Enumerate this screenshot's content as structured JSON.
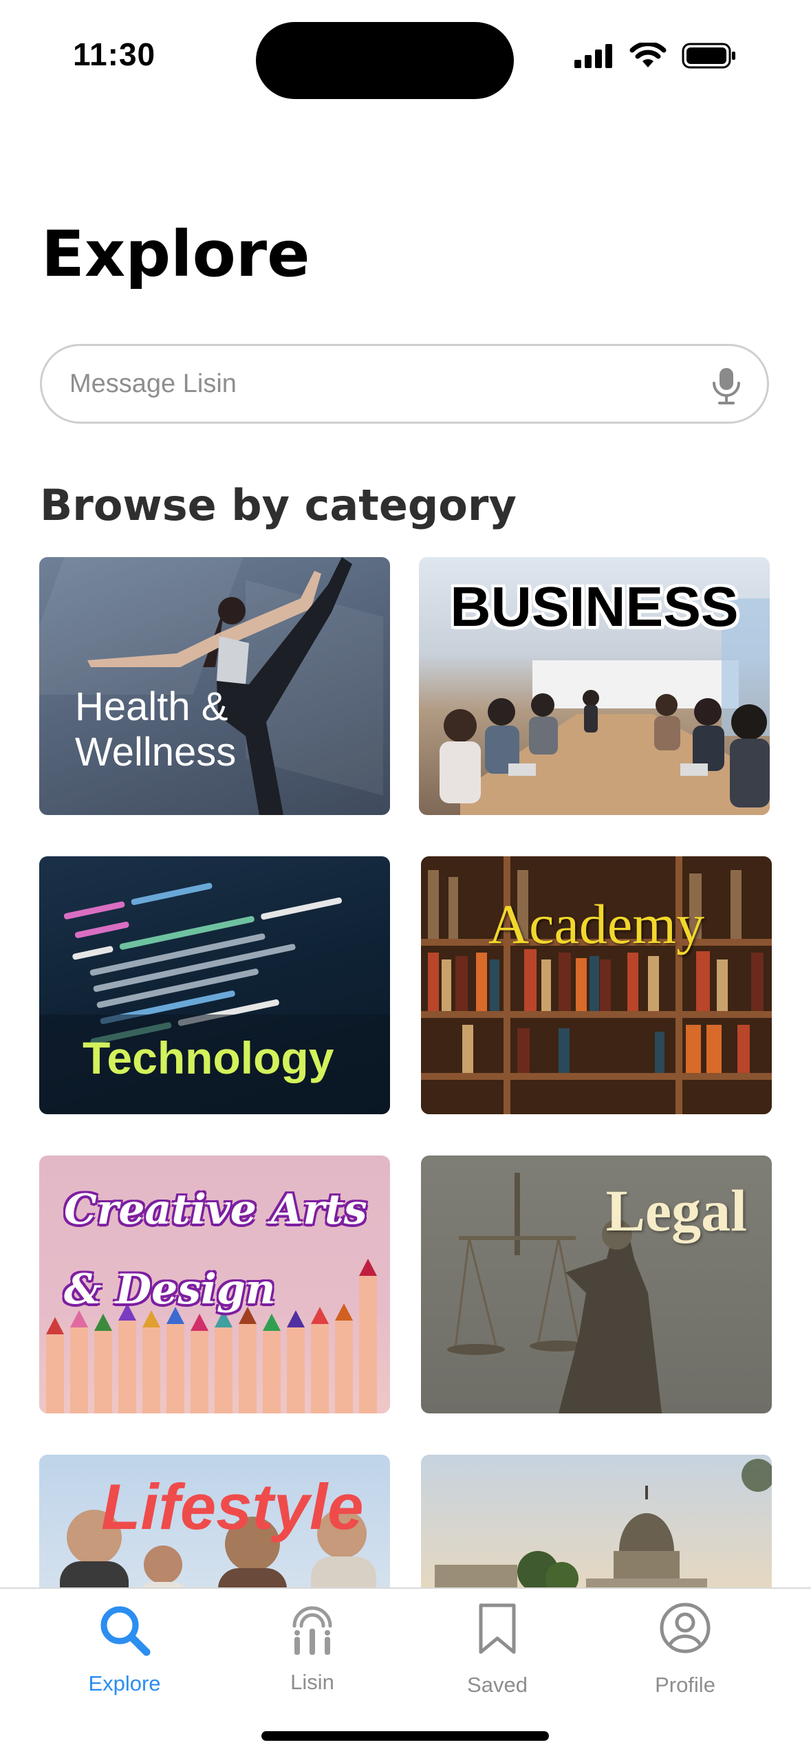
{
  "status_bar": {
    "time": "11:30"
  },
  "header": {
    "title": "Explore"
  },
  "search": {
    "placeholder": "Message Lisin"
  },
  "section": {
    "title": "Browse by category"
  },
  "categories": [
    {
      "label_line1": "Health &",
      "label_line2": "Wellness"
    },
    {
      "label": "BUSINESS"
    },
    {
      "label": "Technology"
    },
    {
      "label": "Academy"
    },
    {
      "label_line1": "Creative Arts",
      "label_line2": "& Design"
    },
    {
      "label": "Legal"
    },
    {
      "label": "Lifestyle"
    },
    {
      "label": ""
    }
  ],
  "tabs": [
    {
      "label": "Explore",
      "icon": "search-icon",
      "active": true
    },
    {
      "label": "Lisin",
      "icon": "lisin-icon",
      "active": false
    },
    {
      "label": "Saved",
      "icon": "bookmark-icon",
      "active": false
    },
    {
      "label": "Profile",
      "icon": "profile-icon",
      "active": false
    }
  ],
  "colors": {
    "accent": "#2b8ef0",
    "inactive": "#8e8e8e"
  }
}
